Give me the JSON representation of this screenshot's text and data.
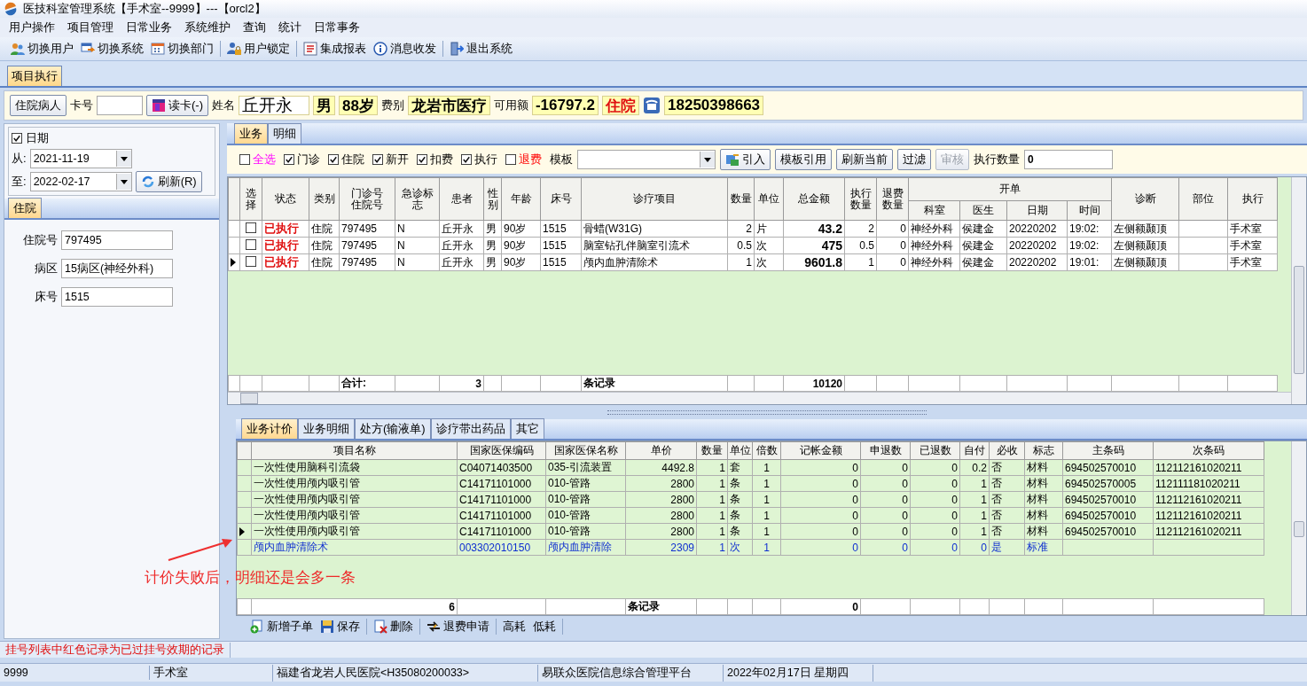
{
  "window": {
    "title": "医技科室管理系统【手术室--9999】---【orcl2】"
  },
  "menu": [
    "用户操作",
    "项目管理",
    "日常业务",
    "系统维护",
    "查询",
    "统计",
    "日常事务"
  ],
  "toolbar": [
    [
      "切换用户",
      "切换系统",
      "切换部门"
    ],
    [
      "用户锁定"
    ],
    [
      "集成报表",
      "消息收发"
    ],
    [
      "退出系统"
    ]
  ],
  "doc_tabs": [
    {
      "label": "项目执行",
      "selected": true
    }
  ],
  "patient_bar": {
    "type_button": "住院病人",
    "card_label": "卡号",
    "read_card_button": "读卡(-)",
    "name_label": "姓名",
    "name": "丘开永",
    "sex": "男",
    "age": "88岁",
    "fee_label": "费别",
    "fee_type": "龙岩市医疗",
    "balance_label": "可用额",
    "balance": "-16797.2",
    "status": "住院",
    "phone": "18250398663"
  },
  "left_panel": {
    "date_filter": {
      "label": "日期",
      "checked": true
    },
    "from_label": "从:",
    "from": "2021-11-19",
    "to_label": "至:",
    "to": "2022-02-17",
    "refresh_button": "刷新(R)",
    "tabs": [
      {
        "label": "住院",
        "selected": true
      }
    ],
    "fields": [
      {
        "label": "住院号",
        "value": "797495"
      },
      {
        "label": "病区",
        "value": "15病区(神经外科)"
      },
      {
        "label": "床号",
        "value": "1515"
      }
    ]
  },
  "main_tabs": [
    {
      "label": "业务",
      "selected": true
    },
    {
      "label": "明细",
      "selected": false
    }
  ],
  "filters": {
    "checks": [
      {
        "label": "全选",
        "checked": false,
        "kind": "select_all"
      },
      {
        "label": "门诊",
        "checked": true,
        "kind": "normal"
      },
      {
        "label": "住院",
        "checked": true,
        "kind": "normal"
      },
      {
        "label": "新开",
        "checked": true,
        "kind": "normal"
      },
      {
        "label": "扣费",
        "checked": true,
        "kind": "normal"
      },
      {
        "label": "执行",
        "checked": true,
        "kind": "normal"
      },
      {
        "label": "退费",
        "checked": false,
        "kind": "refund"
      }
    ],
    "template_label": "模板",
    "buttons": [
      {
        "label": "引入",
        "disabled": false
      },
      {
        "label": "模板引用",
        "disabled": false
      },
      {
        "label": "刷新当前",
        "disabled": false
      },
      {
        "label": "过滤",
        "disabled": false
      },
      {
        "label": "审核",
        "disabled": true
      }
    ],
    "count_label": "执行数量",
    "count": "0"
  },
  "orders_table": {
    "columns": [
      {
        "label": "选择"
      },
      {
        "label": "状态"
      },
      {
        "label": "类别"
      },
      {
        "label": "门诊号住院号"
      },
      {
        "label": "急诊标志"
      },
      {
        "label": "患者"
      },
      {
        "label": "性别"
      },
      {
        "label": "年龄"
      },
      {
        "label": "床号"
      },
      {
        "label": "诊疗项目"
      },
      {
        "label": "数量"
      },
      {
        "label": "单位"
      },
      {
        "label": "总金额"
      },
      {
        "label": "执行数量"
      },
      {
        "label": "退费数量"
      },
      {
        "label": "开单",
        "colspan": 4,
        "children": [
          {
            "label": "科室"
          },
          {
            "label": "医生"
          },
          {
            "label": "日期"
          },
          {
            "label": "时间"
          }
        ]
      },
      {
        "label": "诊断"
      },
      {
        "label": "部位"
      },
      {
        "label": "执行"
      }
    ],
    "rows": [
      {
        "selected": false,
        "checked": false,
        "cells": [
          null,
          "已执行",
          "住院",
          "797495",
          "N",
          "丘开永",
          "男",
          "90岁",
          "1515",
          "骨蜡(W31G)",
          "2",
          "片",
          "43.2",
          "2",
          "0",
          "神经外科",
          "侯建金",
          "20220202",
          "19:02:",
          "左侧额颞顶",
          null,
          "手术室"
        ]
      },
      {
        "selected": false,
        "checked": false,
        "cells": [
          null,
          "已执行",
          "住院",
          "797495",
          "N",
          "丘开永",
          "男",
          "90岁",
          "1515",
          "脑室钻孔伴脑室引流术",
          "0.5",
          "次",
          "475",
          "0.5",
          "0",
          "神经外科",
          "侯建金",
          "20220202",
          "19:02:",
          "左侧额颞顶",
          null,
          "手术室"
        ]
      },
      {
        "selected": true,
        "checked": false,
        "cells": [
          null,
          "已执行",
          "住院",
          "797495",
          "N",
          "丘开永",
          "男",
          "90岁",
          "1515",
          "颅内血肿清除术",
          "1",
          "次",
          "9601.8",
          "1",
          "0",
          "神经外科",
          "侯建金",
          "20220202",
          "19:01:",
          "左侧额颞顶",
          null,
          "手术室"
        ]
      }
    ],
    "footer": {
      "label": "合计:",
      "count": "3",
      "unit": "条记录",
      "total": "10120"
    }
  },
  "detail_tabs": [
    {
      "label": "业务计价",
      "selected": true
    },
    {
      "label": "业务明细",
      "selected": false
    },
    {
      "label": "处方(输液单)",
      "selected": false
    },
    {
      "label": "诊疗带出药品",
      "selected": false
    },
    {
      "label": "其它",
      "selected": false
    }
  ],
  "charges_table": {
    "columns": [
      "项目名称",
      "国家医保编码",
      "国家医保名称",
      "单价",
      "数量",
      "单位",
      "倍数",
      "记帐金额",
      "申退数",
      "已退数",
      "自付",
      "必收",
      "标志",
      "主条码",
      "次条码"
    ],
    "rows": [
      {
        "kind": "material",
        "selected": false,
        "cells": [
          "一次性使用脑科引流袋",
          "C04071403500",
          "035-引流装置",
          "4492.8",
          "1",
          "套",
          "1",
          "0",
          "0",
          "0",
          "0.2",
          "否",
          "材料",
          "694502570010",
          "112112161020211"
        ]
      },
      {
        "kind": "material",
        "selected": false,
        "cells": [
          "一次性使用颅内吸引管",
          "C14171101000",
          "010-管路",
          "2800",
          "1",
          "条",
          "1",
          "0",
          "0",
          "0",
          "1",
          "否",
          "材料",
          "694502570005",
          "112111181020211"
        ]
      },
      {
        "kind": "material",
        "selected": false,
        "cells": [
          "一次性使用颅内吸引管",
          "C14171101000",
          "010-管路",
          "2800",
          "1",
          "条",
          "1",
          "0",
          "0",
          "0",
          "1",
          "否",
          "材料",
          "694502570010",
          "112112161020211"
        ]
      },
      {
        "kind": "material",
        "selected": false,
        "cells": [
          "一次性使用颅内吸引管",
          "C14171101000",
          "010-管路",
          "2800",
          "1",
          "条",
          "1",
          "0",
          "0",
          "0",
          "1",
          "否",
          "材料",
          "694502570010",
          "112112161020211"
        ]
      },
      {
        "kind": "material",
        "selected": true,
        "cells": [
          "一次性使用颅内吸引管",
          "C14171101000",
          "010-管路",
          "2800",
          "1",
          "条",
          "1",
          "0",
          "0",
          "0",
          "1",
          "否",
          "材料",
          "694502570010",
          "112112161020211"
        ]
      },
      {
        "kind": "standard",
        "selected": false,
        "cells": [
          "颅内血肿清除术",
          "003302010150",
          "颅内血肿清除",
          "2309",
          "1",
          "次",
          "1",
          "0",
          "0",
          "0",
          "0",
          "是",
          "标准",
          null,
          null
        ]
      }
    ],
    "footer": {
      "count": "6",
      "unit": "条记录",
      "total": "0"
    }
  },
  "annotation": "计价失败后，明细还是会多一条",
  "bottom_toolbar": [
    [
      "新增子单",
      "保存"
    ],
    [
      "删除"
    ],
    [
      "退费申请"
    ],
    [
      "高耗",
      "低耗"
    ]
  ],
  "notice": "挂号列表中红色记录为已过挂号效期的记录",
  "status_bar": [
    "9999",
    "手术室",
    "福建省龙岩人民医院<H35080200033>",
    "易联众医院信息综合管理平台",
    "2022年02月17日 星期四"
  ]
}
